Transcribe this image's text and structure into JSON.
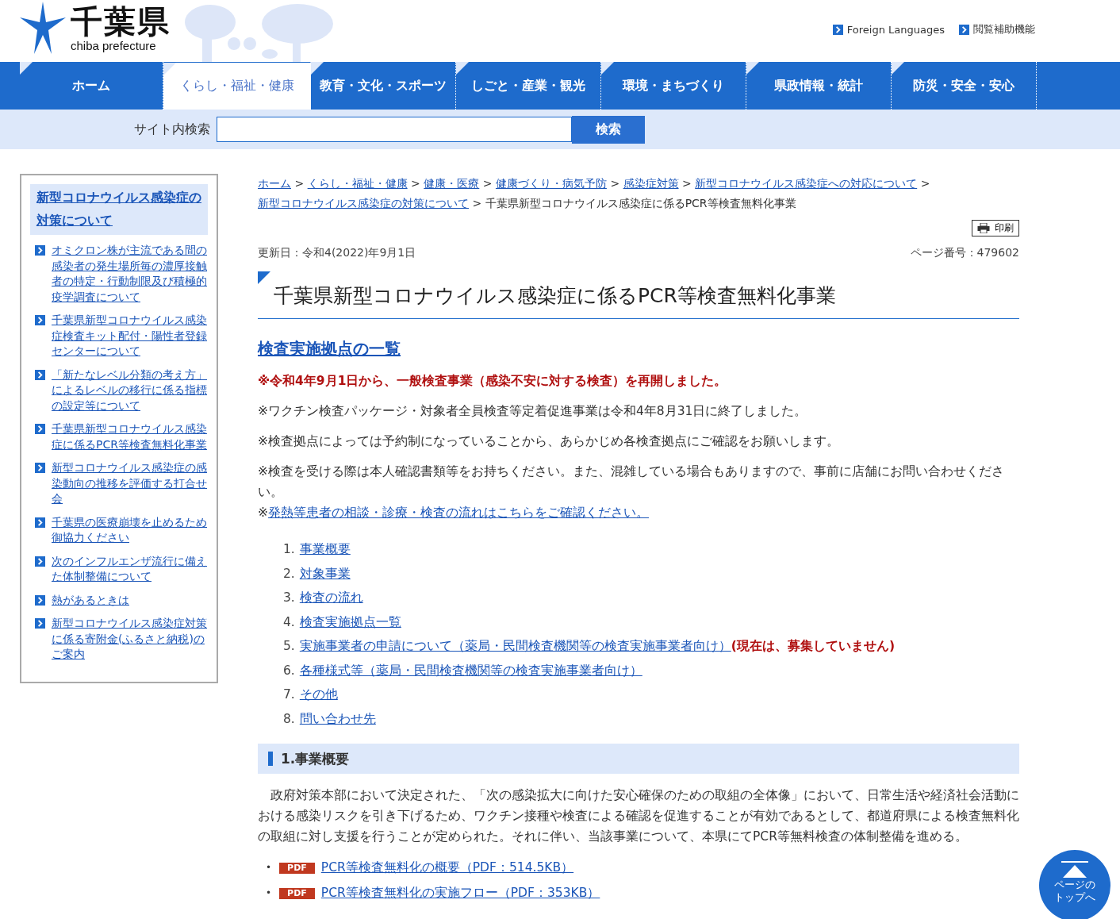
{
  "header": {
    "logo": {
      "name": "千葉県",
      "sub": "chiba prefecture"
    },
    "utility_links": [
      "Foreign Languages",
      "閲覧補助機能"
    ]
  },
  "nav": {
    "items": [
      {
        "label": "ホーム",
        "selected": false
      },
      {
        "label": "くらし・福祉・健康",
        "selected": true
      },
      {
        "label": "教育・文化・スポーツ",
        "selected": false
      },
      {
        "label": "しごと・産業・観光",
        "selected": false
      },
      {
        "label": "環境・まちづくり",
        "selected": false
      },
      {
        "label": "県政情報・統計",
        "selected": false
      },
      {
        "label": "防災・安全・安心",
        "selected": false
      }
    ]
  },
  "search": {
    "label": "サイト内検索",
    "button": "検索"
  },
  "sidebar": {
    "title": "新型コロナウイルス感染症の対策について",
    "items": [
      "オミクロン株が主流である間の感染者の発生場所毎の濃厚接触者の特定・行動制限及び積極的疫学調査について",
      "千葉県新型コロナウイルス感染症検査キット配付・陽性者登録センターについて",
      "「新たなレベル分類の考え方」によるレベルの移行に係る指標の設定等について",
      "千葉県新型コロナウイルス感染症に係るPCR等検査無料化事業",
      "新型コロナウイルス感染症の感染動向の推移を評価する打合せ会",
      "千葉県の医療崩壊を止めるため御協力ください",
      "次のインフルエンザ流行に備えた体制整備について",
      "熱があるときは",
      "新型コロナウイルス感染症対策に係る寄附金(ふるさと納税)のご案内"
    ]
  },
  "breadcrumb": {
    "separator": ">",
    "links": [
      "ホーム",
      "くらし・福祉・健康",
      "健康・医療",
      "健康づくり・病気予防",
      "感染症対策",
      "新型コロナウイルス感染症への対応について",
      "新型コロナウイルス感染症の対策について"
    ],
    "current": "千葉県新型コロナウイルス感染症に係るPCR等検査無料化事業"
  },
  "print_button": "印刷",
  "updated": "更新日：令和4(2022)年9月1日",
  "page_number": "ページ番号：479602",
  "title": "千葉県新型コロナウイルス感染症に係るPCR等検査無料化事業",
  "section_link": "検査実施拠点の一覧",
  "notices": [
    {
      "kind": "alert",
      "text": "※令和4年9月1日から、一般検査事業（感染不安に対する検査）を再開しました。"
    },
    {
      "kind": "plain",
      "text": "※ワクチン検査パッケージ・対象者全員検査等定着促進事業は令和4年8月31日に終了しました。"
    },
    {
      "kind": "plain",
      "text": "※検査拠点によっては予約制になっていることから、あらかじめ各検査拠点にご確認をお願いします。"
    },
    {
      "kind": "plain",
      "text": "※検査を受ける際は本人確認書類等をお持ちください。また、混雑している場合もありますので、事前に店舗にお問い合わせください。"
    },
    {
      "kind": "link",
      "prefix": "※",
      "text": "発熱等患者の相談・診療・検査の流れはこちらをご確認ください。"
    }
  ],
  "toc": [
    {
      "number": "1.",
      "label": "事業概要"
    },
    {
      "number": "2.",
      "label": "対象事業"
    },
    {
      "number": "3.",
      "label": "検査の流れ"
    },
    {
      "number": "4.",
      "label": "検査実施拠点一覧"
    },
    {
      "number": "5.",
      "label": "実施事業者の申請について（薬局・民間検査機関等の検査実施事業者向け）",
      "note": "(現在は、募集していません)"
    },
    {
      "number": "6.",
      "label": "各種様式等（薬局・民間検査機関等の検査実施事業者向け）"
    },
    {
      "number": "7.",
      "label": "その他"
    },
    {
      "number": "8.",
      "label": "問い合わせ先"
    }
  ],
  "section": {
    "heading": "1.事業概要",
    "paragraph": "政府対策本部において決定された、「次の感染拡大に向けた安心確保のための取組の全体像」において、日常生活や経済社会活動における感染リスクを引き下げるため、ワクチン接種や検査による確認を促進することが有効であるとして、都道府県による検査無料化の取組に対し支援を行うことが定められた。それに伴い、当該事業について、本県にてPCR等無料検査の体制整備を進める。",
    "files": [
      {
        "marker": "•",
        "badge": "PDF",
        "label": "PCR等検査無料化の概要（PDF：514.5KB）"
      },
      {
        "marker": "•",
        "badge": "PDF",
        "label": "PCR等検査無料化の実施フロー（PDF：353KB）"
      }
    ]
  },
  "back_to_top": [
    "ページの",
    "トップへ"
  ]
}
